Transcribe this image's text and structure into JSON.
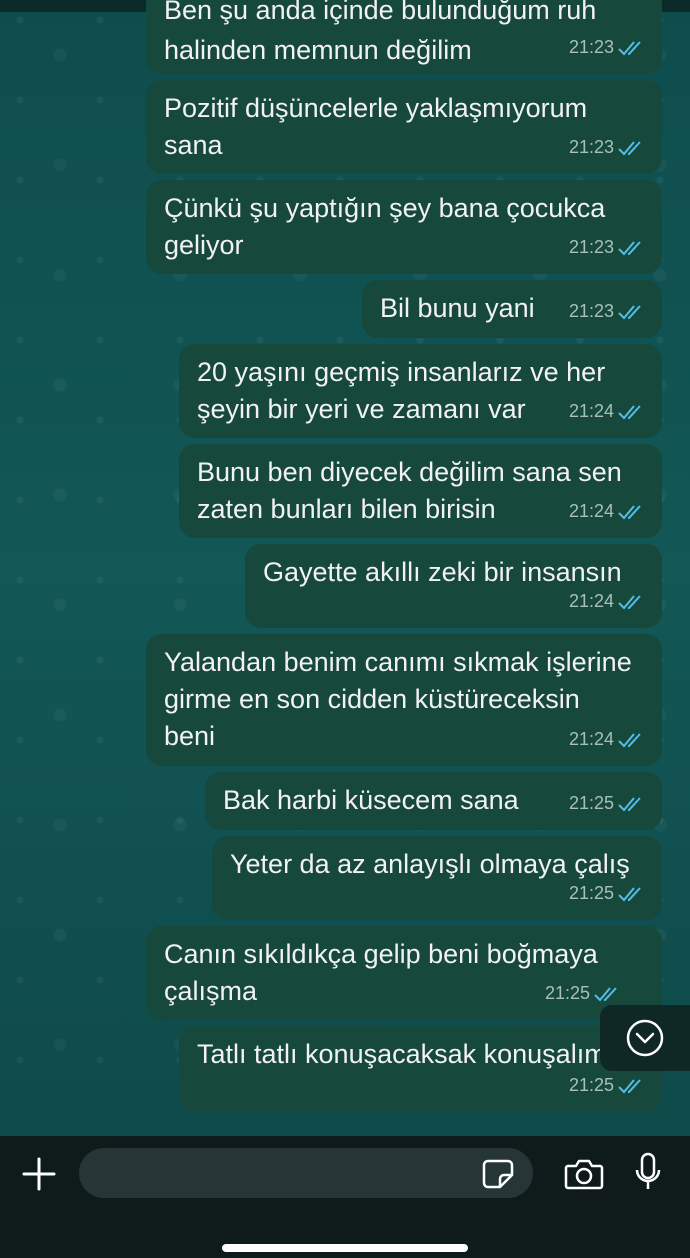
{
  "messages": [
    {
      "text": "Ben şu anda içinde bulunduğum ruh\nhalinden memnun değilim",
      "time": "21:23"
    },
    {
      "text": "Pozitif düşüncelerle yaklaşmıyorum\nsana",
      "time": "21:23"
    },
    {
      "text": "Çünkü şu yaptığın şey bana çocukca\ngeliyor",
      "time": "21:23"
    },
    {
      "text": "Bil bunu yani",
      "time": "21:23"
    },
    {
      "text": "20 yaşını geçmiş insanlarız ve her\nşeyin bir yeri ve zamanı var",
      "time": "21:24"
    },
    {
      "text": "Bunu ben diyecek değilim sana sen\nzaten bunları bilen birisin",
      "time": "21:24"
    },
    {
      "text": "Gayette akıllı zeki bir insansın",
      "time": "21:24"
    },
    {
      "text": "Yalandan benim canımı sıkmak işlerine\ngirme en son cidden küstüreceksin\nbeni",
      "time": "21:24"
    },
    {
      "text": "Bak harbi küsecem sana",
      "time": "21:25"
    },
    {
      "text": "Yeter da az anlayışlı olmaya çalış",
      "time": "21:25"
    },
    {
      "text": "Canın sıkıldıkça gelip beni boğmaya\nçalışma",
      "time": "21:25"
    },
    {
      "text": "Tatlı tatlı konuşacaksak konuşalım",
      "time": "21:25"
    }
  ],
  "composer": {
    "value": "",
    "placeholder": ""
  },
  "icons": {
    "read_receipt": "double-check-icon",
    "scroll_down": "chevron-down-icon",
    "attach": "plus-icon",
    "sticker": "sticker-icon",
    "camera": "camera-icon",
    "mic": "mic-icon"
  },
  "colors": {
    "bubble": "#16483b",
    "read_tick": "#53bdeb",
    "chat_bg": "#125050",
    "composer_bg": "#0f1b1b"
  }
}
